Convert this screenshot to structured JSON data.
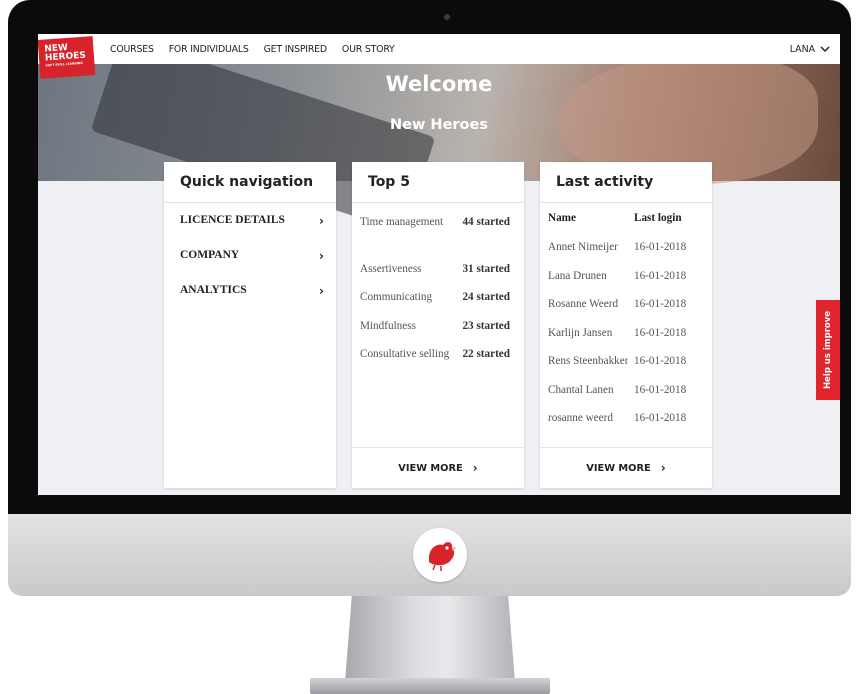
{
  "brand": {
    "line1": "NEW",
    "line2": "HEROES",
    "tagline": "SOFT SKILL LEARNING"
  },
  "nav": {
    "items": [
      "COURSES",
      "FOR INDIVIDUALS",
      "GET INSPIRED",
      "OUR STORY"
    ]
  },
  "user": {
    "name": "LANA"
  },
  "hero": {
    "title": "Welcome",
    "subtitle": "New Heroes"
  },
  "quick_navigation": {
    "title": "Quick navigation",
    "items": [
      "LICENCE DETAILS",
      "COMPANY",
      "ANALYTICS"
    ]
  },
  "top5": {
    "title": "Top 5",
    "items": [
      {
        "name": "Time management",
        "count": "44 started"
      },
      {
        "name": "Assertiveness",
        "count": "31 started"
      },
      {
        "name": "Communicating",
        "count": "24 started"
      },
      {
        "name": "Mindfulness",
        "count": "23 started"
      },
      {
        "name": "Consultative selling",
        "count": "22 started"
      }
    ],
    "view_more": "VIEW MORE"
  },
  "last_activity": {
    "title": "Last activity",
    "col_name": "Name",
    "col_login": "Last login",
    "rows": [
      {
        "name": "Annet Nimeijer",
        "date": "16-01-2018"
      },
      {
        "name": "Lana Drunen",
        "date": "16-01-2018"
      },
      {
        "name": "Rosanne Weerd",
        "date": "16-01-2018"
      },
      {
        "name": "Karlijn Jansen",
        "date": "16-01-2018"
      },
      {
        "name": "Rens Steenbakkers",
        "date": "16-01-2018"
      },
      {
        "name": "Chantal Lanen",
        "date": "16-01-2018"
      },
      {
        "name": "rosanne weerd",
        "date": "16-01-2018"
      }
    ],
    "view_more": "VIEW MORE"
  },
  "feedback": {
    "label": "Help us improve"
  },
  "colors": {
    "accent": "#d8232a",
    "background": "#eef0f4"
  }
}
